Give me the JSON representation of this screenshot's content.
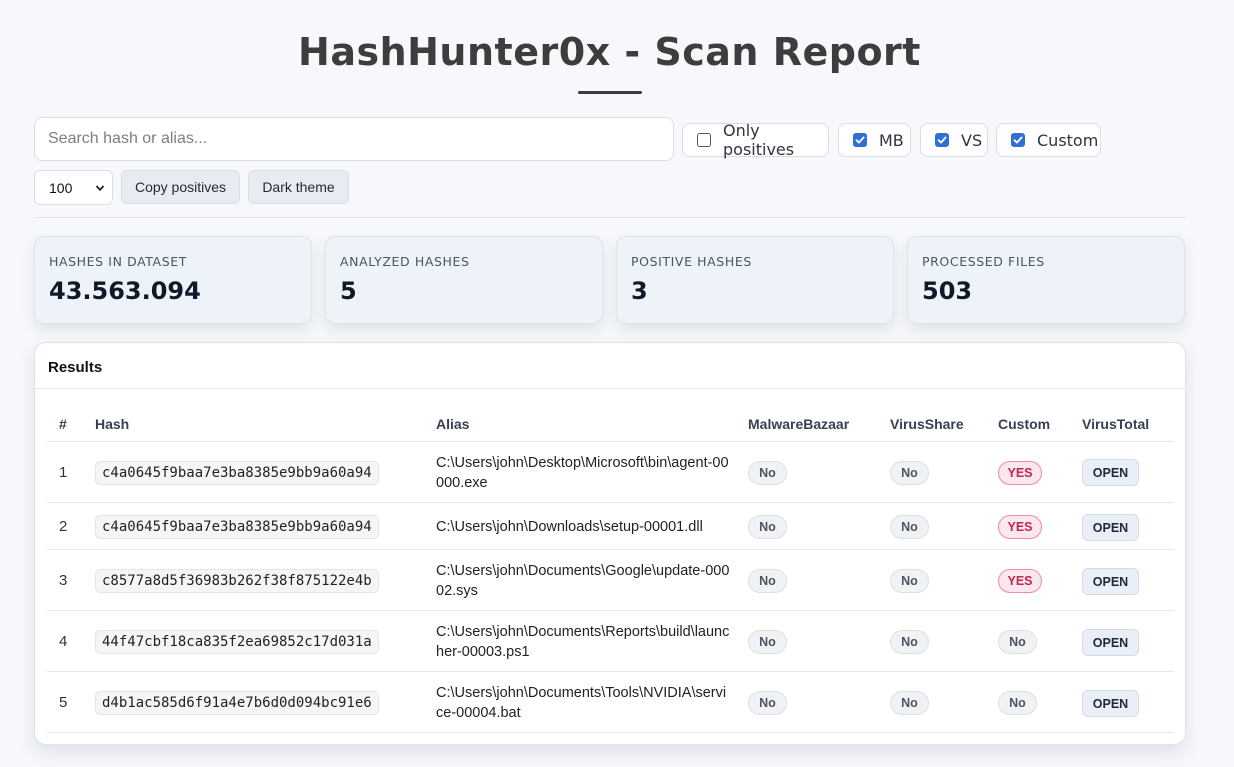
{
  "header": {
    "title": "HashHunter0x - Scan Report"
  },
  "toolbar": {
    "search_placeholder": "Search hash or alias...",
    "search_value": "",
    "filters": [
      {
        "label": "Only positives",
        "checked": false
      },
      {
        "label": "MB",
        "checked": true
      },
      {
        "label": "VS",
        "checked": true
      },
      {
        "label": "Custom",
        "checked": true
      }
    ],
    "page_size": "100",
    "copy_label": "Copy positives",
    "theme_label": "Dark theme"
  },
  "stats": [
    {
      "label": "HASHES IN DATASET",
      "value": "43.563.094"
    },
    {
      "label": "ANALYZED HASHES",
      "value": "5"
    },
    {
      "label": "POSITIVE HASHES",
      "value": "3"
    },
    {
      "label": "PROCESSED FILES",
      "value": "503"
    }
  ],
  "results": {
    "title": "Results",
    "columns": [
      "#",
      "Hash",
      "Alias",
      "MalwareBazaar",
      "VirusShare",
      "Custom",
      "VirusTotal"
    ],
    "rows": [
      {
        "num": "1",
        "hash": "c4a0645f9baa7e3ba8385e9bb9a60a94",
        "alias": "C:\\Users\\john\\Desktop\\Microsoft\\bin\\agent-00000.exe",
        "mb": "No",
        "vs": "No",
        "custom": "YES",
        "vt": "OPEN"
      },
      {
        "num": "2",
        "hash": "c4a0645f9baa7e3ba8385e9bb9a60a94",
        "alias": "C:\\Users\\john\\Downloads\\setup-00001.dll",
        "mb": "No",
        "vs": "No",
        "custom": "YES",
        "vt": "OPEN"
      },
      {
        "num": "3",
        "hash": "c8577a8d5f36983b262f38f875122e4b",
        "alias": "C:\\Users\\john\\Documents\\Google\\update-00002.sys",
        "mb": "No",
        "vs": "No",
        "custom": "YES",
        "vt": "OPEN"
      },
      {
        "num": "4",
        "hash": "44f47cbf18ca835f2ea69852c17d031a",
        "alias": "C:\\Users\\john\\Documents\\Reports\\build\\launcher-00003.ps1",
        "mb": "No",
        "vs": "No",
        "custom": "No",
        "vt": "OPEN"
      },
      {
        "num": "5",
        "hash": "d4b1ac585d6f91a4e7b6d0d094bc91e6",
        "alias": "C:\\Users\\john\\Documents\\Tools\\NVIDIA\\service-00004.bat",
        "mb": "No",
        "vs": "No",
        "custom": "No",
        "vt": "OPEN"
      }
    ]
  }
}
